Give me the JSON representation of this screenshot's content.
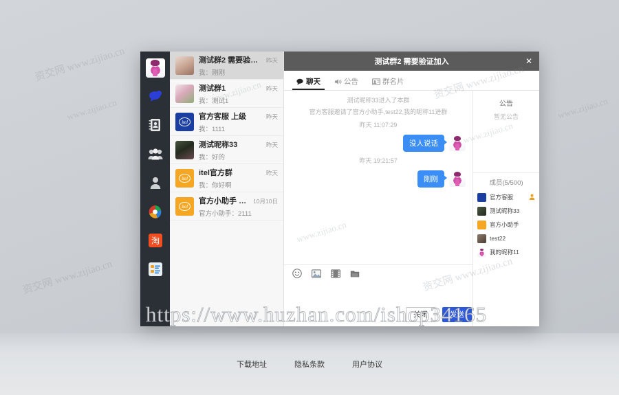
{
  "window": {
    "header_title": "测试群2 需要验证加入",
    "close_icon": "close-icon"
  },
  "rail": {
    "avatar_alt": "my-avatar",
    "items": [
      {
        "icon": "chat-bubble-icon",
        "name": "chat"
      },
      {
        "icon": "contacts-book-icon",
        "name": "contacts"
      },
      {
        "icon": "group-people-icon",
        "name": "groups"
      },
      {
        "icon": "person-icon",
        "name": "profile"
      },
      {
        "icon": "app-circle-icon",
        "name": "app"
      },
      {
        "icon": "taobao-icon",
        "name": "taobao"
      },
      {
        "icon": "list-app-icon",
        "name": "list-app"
      }
    ]
  },
  "conversations": [
    {
      "name": "测试群2 需要验证...",
      "time": "昨天",
      "preview": "我：刚刚",
      "avatar": "photo-woman",
      "active": true
    },
    {
      "name": "测试群1",
      "time": "昨天",
      "preview": "我：测试1",
      "avatar": "photo-flower",
      "active": false
    },
    {
      "name": "官方客服 上级",
      "time": "昨天",
      "preview": "我：1111",
      "avatar": "itel-blue",
      "active": false
    },
    {
      "name": "测试昵称33",
      "time": "昨天",
      "preview": "我：好的",
      "avatar": "photo-dark",
      "active": false
    },
    {
      "name": "itel官方群",
      "time": "昨天",
      "preview": "我：你好啊",
      "avatar": "itel-orange",
      "active": false
    },
    {
      "name": "官方小助手 官方",
      "time": "10月10日",
      "preview": "官方小助手：2111",
      "avatar": "itel-orange",
      "active": false
    }
  ],
  "tabs": [
    {
      "label": "聊天",
      "icon": "chat-icon",
      "active": true
    },
    {
      "label": "公告",
      "icon": "speaker-icon",
      "active": false
    },
    {
      "label": "群名片",
      "icon": "card-icon",
      "active": false
    }
  ],
  "messages": {
    "system": [
      "测试昵称33进入了本群",
      "官方客服邀请了官方小助手,test22,我的昵称11进群"
    ],
    "timestamp_1": "昨天 11:07:29",
    "bubble_1": "没人说话",
    "timestamp_2": "昨天 19:21:57",
    "bubble_2": "刚刚"
  },
  "compose": {
    "placeholder": "",
    "value": "",
    "tools": [
      {
        "name": "emoji-icon",
        "label": "表情"
      },
      {
        "name": "image-icon",
        "label": "图片"
      },
      {
        "name": "video-icon",
        "label": "视频"
      },
      {
        "name": "file-icon",
        "label": "文件"
      }
    ],
    "close_label": "关闭",
    "send_label": "发送"
  },
  "notice": {
    "title": "公告",
    "empty": "暂无公告"
  },
  "members": {
    "title": "成员(5/500)",
    "list": [
      {
        "name": "官方客服",
        "avatar": "itel-blue",
        "owner": true
      },
      {
        "name": "测试昵称33",
        "avatar": "photo-dark",
        "owner": false
      },
      {
        "name": "官方小助手",
        "avatar": "itel-orange",
        "owner": false
      },
      {
        "name": "test22",
        "avatar": "photo-brown",
        "owner": false
      },
      {
        "name": "我的昵称11",
        "avatar": "anime",
        "owner": false
      }
    ]
  },
  "page_footer": {
    "links": [
      "下载地址",
      "隐私条款",
      "用户协议"
    ]
  },
  "watermarks": {
    "url": "https://www.huzhan.com/ishop34165",
    "site": "资交网 www.zijiao.cn",
    "site_short": "www.zijiao.cn"
  },
  "colors": {
    "accent_blue": "#3a8ef6",
    "primary_button": "#2b57d8",
    "rail_bg": "#2b2f36",
    "header_bg": "#5b5b5b"
  }
}
